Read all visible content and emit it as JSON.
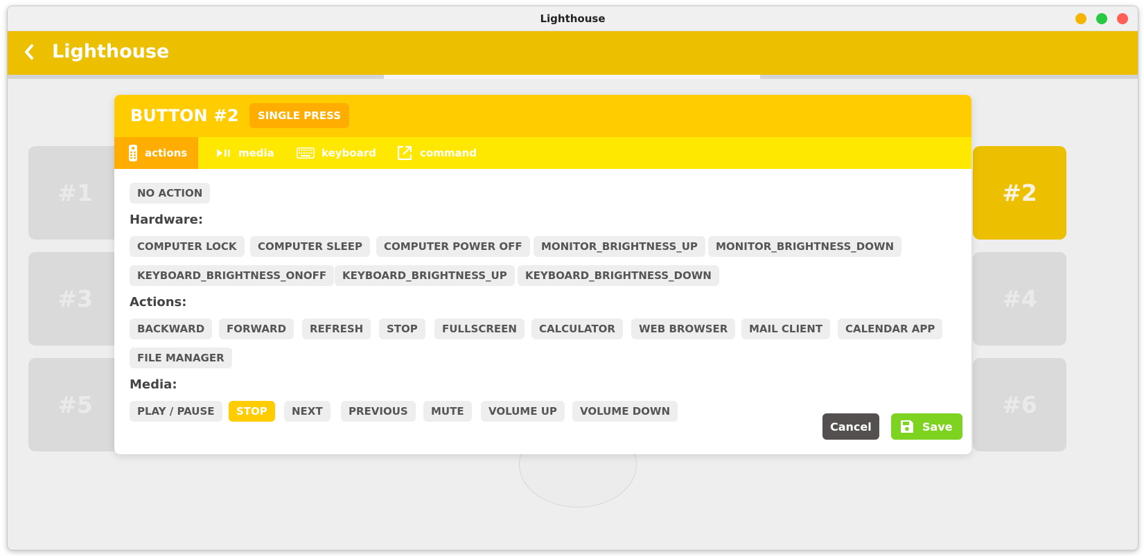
{
  "window": {
    "title": "Lighthouse"
  },
  "colors": {
    "traffic_min": "#f4b400",
    "traffic_max": "#28c840",
    "traffic_close": "#ff5f57",
    "appbar": "#ecc000",
    "modal_header": "#ffcc00",
    "modal_tabs": "#ffe800",
    "tab_active": "#ffad00",
    "press_badge": "#ffad00",
    "chip_selected": "#ffcc00",
    "tile": "#dadada",
    "tile_active": "#ecc000",
    "cancel": "#555050",
    "save": "#7ed321"
  },
  "appbar": {
    "back_icon": "chevron-left-icon",
    "title": "Lighthouse"
  },
  "tiles": [
    {
      "label": "#1",
      "active": false
    },
    {
      "label": "#2",
      "active": true
    },
    {
      "label": "#3",
      "active": false
    },
    {
      "label": "#4",
      "active": false
    },
    {
      "label": "#5",
      "active": false
    },
    {
      "label": "#6",
      "active": false
    }
  ],
  "modal": {
    "title": "BUTTON #2",
    "press_type": "SINGLE PRESS",
    "tabs": [
      {
        "label": "actions",
        "icon": "remote-icon",
        "active": true
      },
      {
        "label": "media",
        "icon": "play-pause-icon",
        "active": false
      },
      {
        "label": "keyboard",
        "icon": "keyboard-icon",
        "active": false
      },
      {
        "label": "command",
        "icon": "external-link-icon",
        "active": false
      }
    ],
    "no_action": "NO ACTION",
    "sections": {
      "hardware": {
        "label": "Hardware:",
        "items": [
          "COMPUTER LOCK",
          "COMPUTER SLEEP",
          "COMPUTER POWER OFF",
          "MONITOR_BRIGHTNESS_UP",
          "MONITOR_BRIGHTNESS_DOWN",
          "KEYBOARD_BRIGHTNESS_ONOFF",
          "KEYBOARD_BRIGHTNESS_UP",
          "KEYBOARD_BRIGHTNESS_DOWN"
        ]
      },
      "actions": {
        "label": "Actions:",
        "items": [
          "BACKWARD",
          "FORWARD",
          "REFRESH",
          "STOP",
          "FULLSCREEN",
          "CALCULATOR",
          "WEB BROWSER",
          "MAIL CLIENT",
          "CALENDAR APP",
          "FILE MANAGER"
        ]
      },
      "media": {
        "label": "Media:",
        "items": [
          "PLAY / PAUSE",
          "STOP",
          "NEXT",
          "PREVIOUS",
          "MUTE",
          "VOLUME UP",
          "VOLUME DOWN"
        ],
        "selected": "STOP"
      }
    },
    "cancel_label": "Cancel",
    "save_label": "Save",
    "save_icon": "floppy-disk-icon"
  }
}
